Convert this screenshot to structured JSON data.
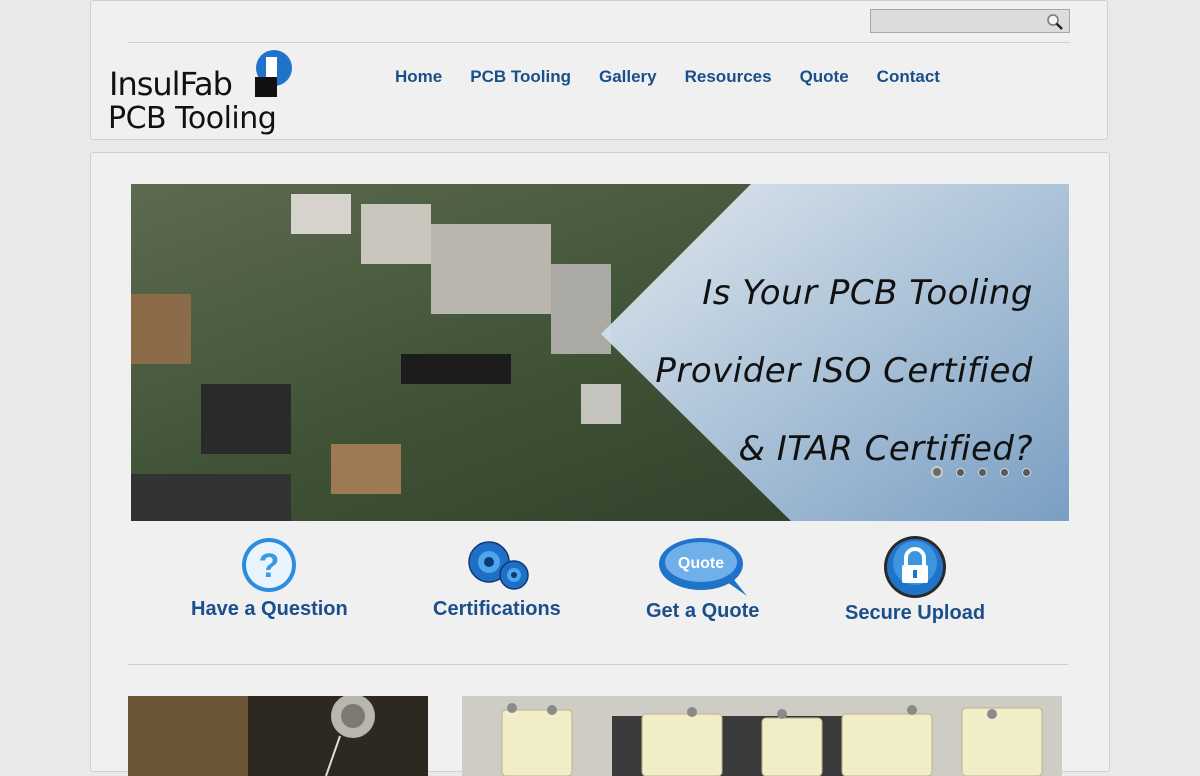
{
  "header": {
    "search": {
      "value": "",
      "placeholder": ""
    },
    "logo": {
      "line1": "InsulFab",
      "line2": "PCB Tooling"
    },
    "nav": [
      {
        "label": "Home"
      },
      {
        "label": "PCB Tooling"
      },
      {
        "label": "Gallery"
      },
      {
        "label": "Resources"
      },
      {
        "label": "Quote"
      },
      {
        "label": "Contact"
      }
    ]
  },
  "hero": {
    "lines": [
      "Is Your PCB Tooling",
      "Provider ISO Certified",
      "& ITAR Certified?"
    ],
    "slide_count": 5,
    "active_slide": 1
  },
  "features": [
    {
      "label": "Have a Question",
      "icon": "question-icon"
    },
    {
      "label": "Certifications",
      "icon": "gears-icon"
    },
    {
      "label": "Get a Quote",
      "icon": "quote-bubble-icon",
      "icon_text": "Quote"
    },
    {
      "label": "Secure Upload",
      "icon": "lock-icon"
    }
  ],
  "colors": {
    "link": "#1a4f8b",
    "accent_blue": "#1f73c8",
    "panel": "#f0f0f0"
  }
}
